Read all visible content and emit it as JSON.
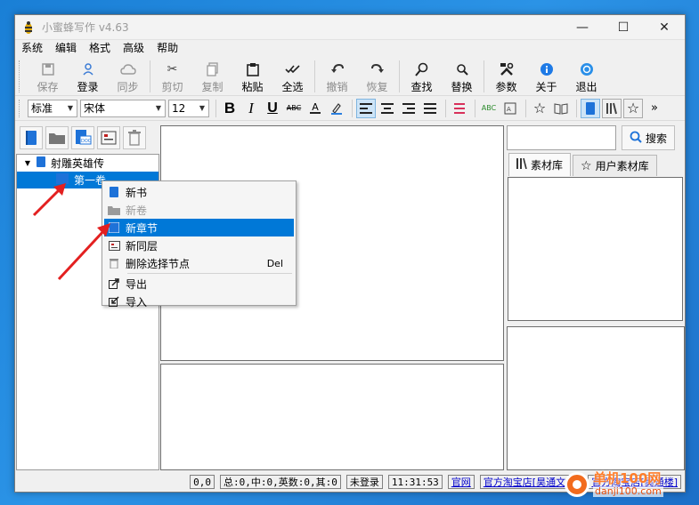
{
  "window": {
    "title": "小蜜蜂写作 v4.63",
    "minimize": "—",
    "maximize": "☐",
    "close": "✕"
  },
  "menu": [
    "系统",
    "编辑",
    "格式",
    "高级",
    "帮助"
  ],
  "toolbar": {
    "save": "保存",
    "login": "登录",
    "sync": "同步",
    "cut": "剪切",
    "copy": "复制",
    "paste": "粘贴",
    "select_all": "全选",
    "undo": "撤销",
    "redo": "恢复",
    "find": "查找",
    "replace": "替换",
    "params": "参数",
    "about": "关于",
    "exit": "退出"
  },
  "format": {
    "style": "标准",
    "font": "宋体",
    "size": "12",
    "more": "»"
  },
  "tree": {
    "root": "射雕英雄传",
    "child": "第一卷"
  },
  "context_menu": {
    "new_book": "新书",
    "new_volume": "新卷",
    "new_chapter": "新章节",
    "new_sibling": "新同层",
    "delete_node": "删除选择节点",
    "delete_shortcut": "Del",
    "export": "导出",
    "import": "导入"
  },
  "search": {
    "button": "搜索"
  },
  "tabs": {
    "material": "素材库",
    "user_material": "用户素材库"
  },
  "status": {
    "position": "0,0",
    "counts": "总:0,中:0,英数:0,其:0",
    "login_state": "未登录",
    "time": "11:31:53",
    "official_site": "官网",
    "taobao": "官方淘宝店[昊通文化]",
    "taobao2": "官方淘宝店[昊通楼]"
  },
  "watermark": {
    "site": "单机100网",
    "url": "danji100.com"
  },
  "colors": {
    "accent": "#0078d7",
    "arrow": "#e32020",
    "book_blue": "#1e72d8"
  }
}
